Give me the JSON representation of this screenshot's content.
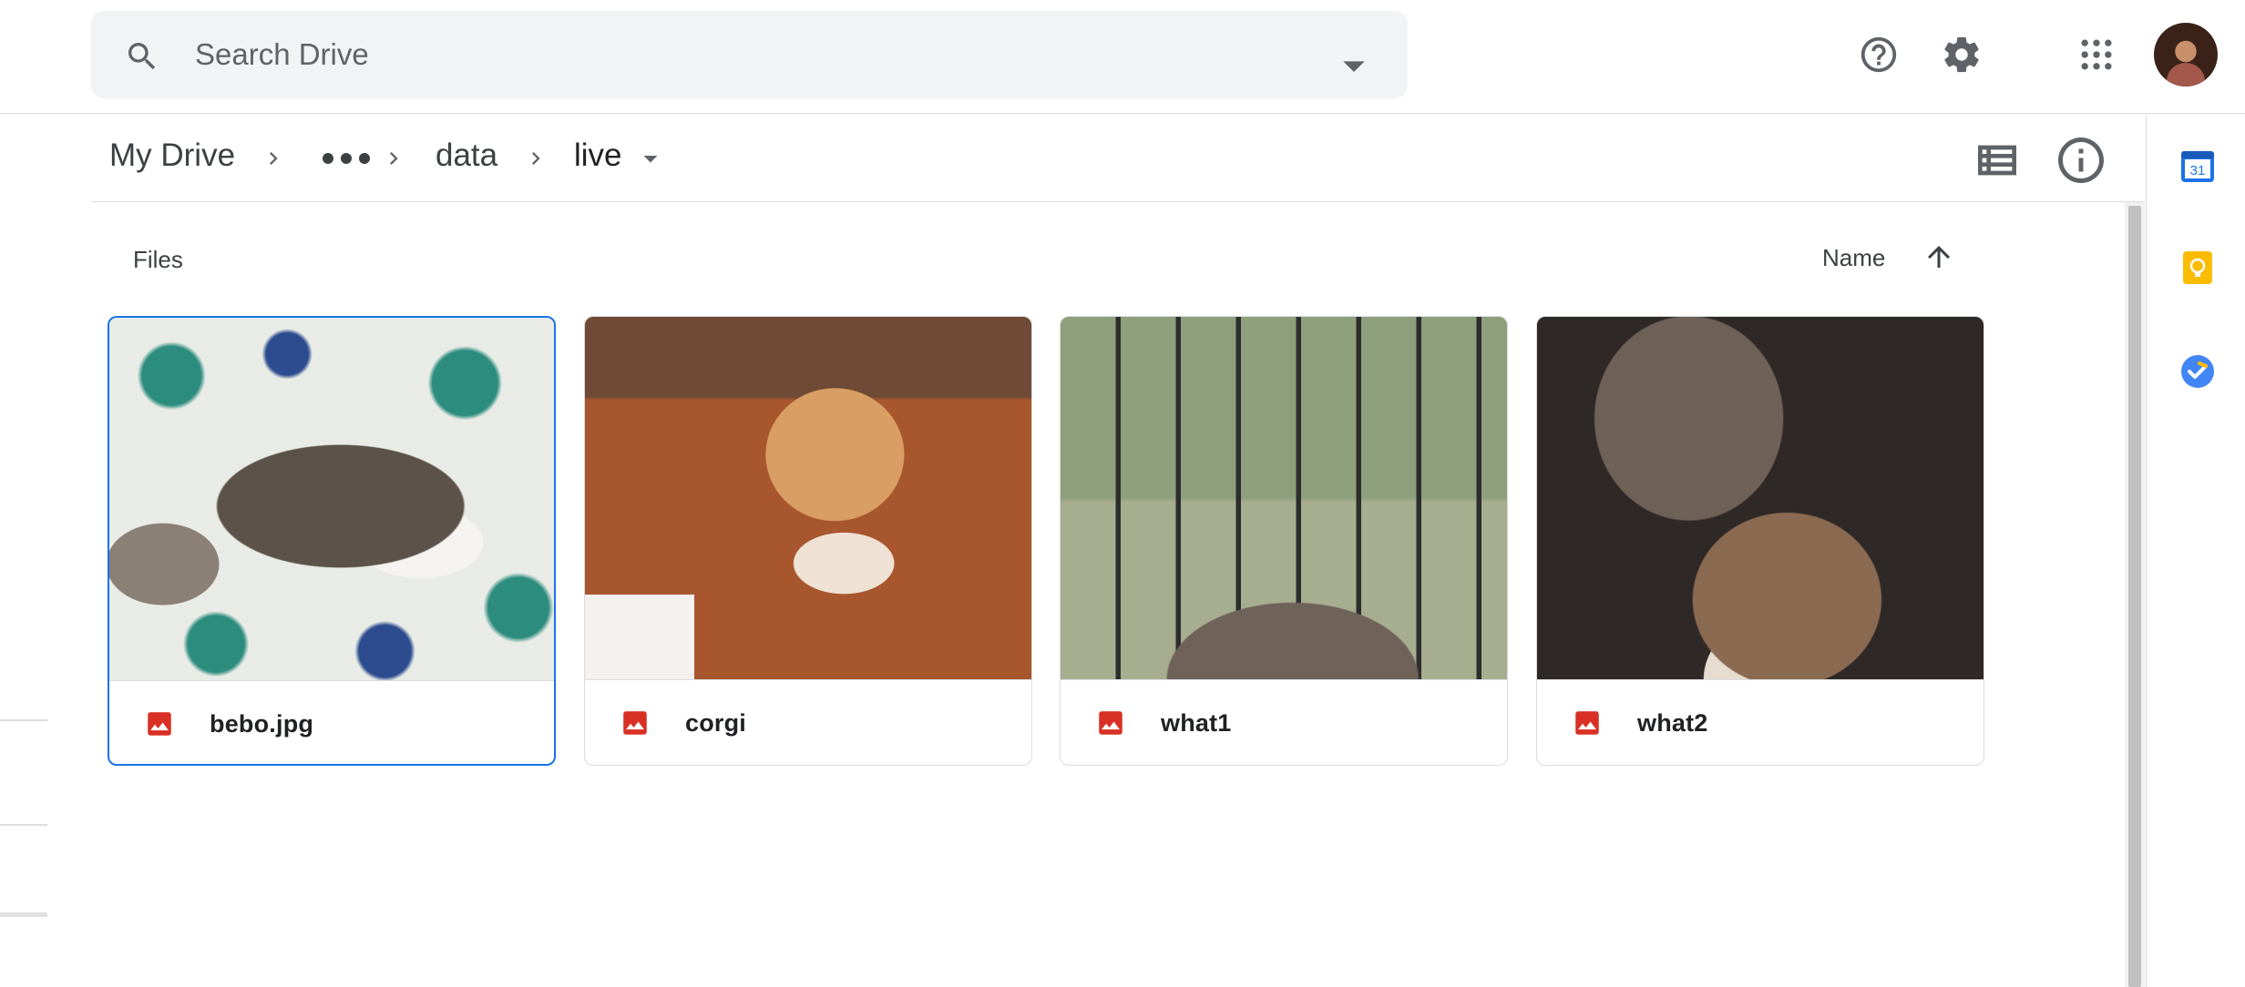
{
  "search": {
    "placeholder": "Search Drive"
  },
  "header": {
    "help_icon": "help-circle-icon",
    "settings_icon": "gear-icon",
    "apps_icon": "apps-grid-icon"
  },
  "breadcrumb": {
    "root": "My Drive",
    "more": "more-horizontal-icon",
    "items": [
      "data",
      "live"
    ]
  },
  "files": {
    "section_label": "Files",
    "sort_label": "Name",
    "sort_direction_icon": "arrow-up-icon",
    "items": [
      {
        "name": "bebo.jpg",
        "selected": true,
        "icon": "image-file-icon"
      },
      {
        "name": "corgi",
        "selected": false,
        "icon": "image-file-icon"
      },
      {
        "name": "what1",
        "selected": false,
        "icon": "image-file-icon"
      },
      {
        "name": "what2",
        "selected": false,
        "icon": "image-file-icon"
      }
    ]
  },
  "side_panel": {
    "calendar_label": "31",
    "icons": [
      "calendar-icon",
      "keep-icon",
      "tasks-icon"
    ]
  },
  "colors": {
    "accent": "#1a73e8",
    "image_file_red": "#d93025",
    "keep_yellow": "#fbbc04",
    "tasks_blue": "#4285f4"
  }
}
